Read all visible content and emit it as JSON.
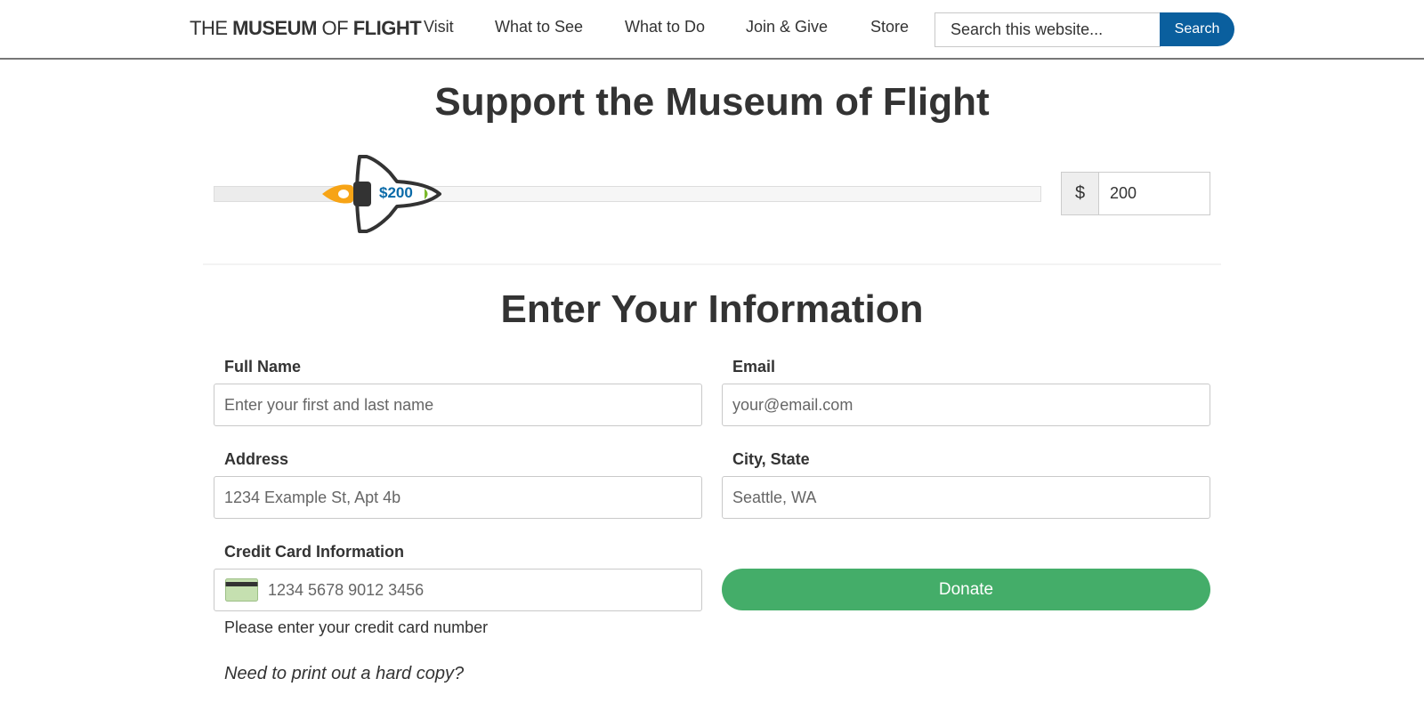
{
  "header": {
    "logo": {
      "the": "THE",
      "museum": "MUSEUM",
      "of": "OF",
      "flight": "FLIGHT"
    },
    "nav": [
      "Visit",
      "What to See",
      "What to Do",
      "Join & Give",
      "Store"
    ],
    "search": {
      "placeholder": "Search this website...",
      "button_label": "Search"
    }
  },
  "support": {
    "title": "Support the Museum of Flight",
    "slider_label": "$200",
    "slider_level_percent": 17,
    "currency_symbol": "$",
    "amount_value": "200"
  },
  "form": {
    "title": "Enter Your Information",
    "full_name": {
      "label": "Full Name",
      "placeholder": "Enter your first and last name"
    },
    "email": {
      "label": "Email",
      "placeholder": "your@email.com"
    },
    "address": {
      "label": "Address",
      "placeholder": "1234 Example St, Apt 4b"
    },
    "city_state": {
      "label": "City, State",
      "placeholder": "Seattle, WA"
    },
    "credit_card": {
      "label": "Credit Card Information",
      "placeholder": "1234 5678 9012 3456",
      "help_text": "Please enter your credit card number",
      "icon": "credit-card-icon"
    },
    "donate_label": "Donate",
    "print_link": "Need to print out a hard copy?"
  },
  "colors": {
    "brand_blue": "#0a5f9e",
    "donate_green": "#44ad69",
    "flame_orange": "#f7a416",
    "text": "#333333"
  }
}
